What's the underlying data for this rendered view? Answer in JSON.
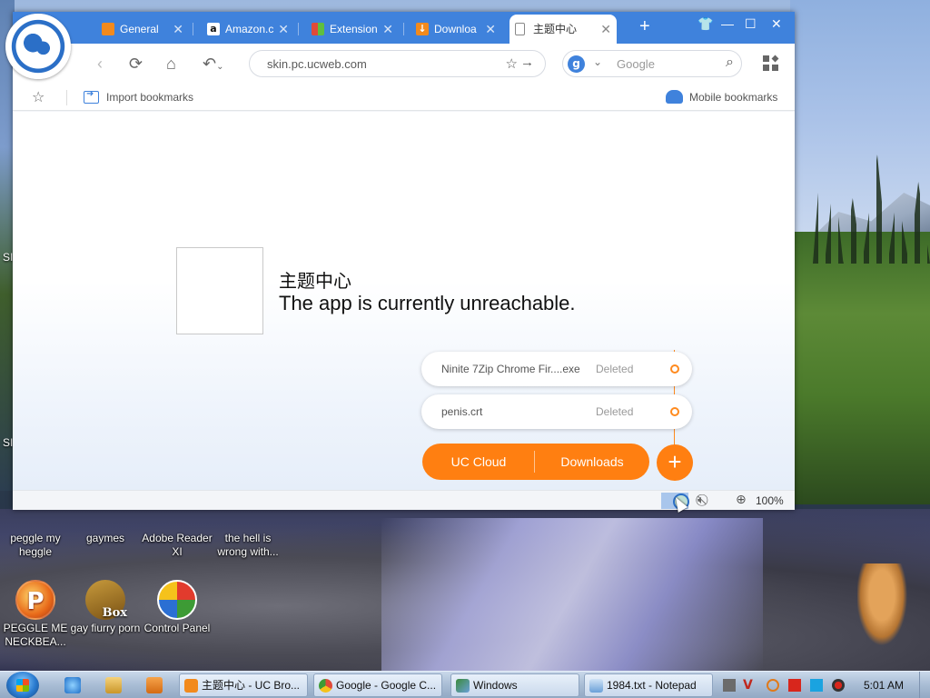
{
  "desktop": {
    "icons": [
      {
        "label": "peggle my heggle"
      },
      {
        "label": "gaymes"
      },
      {
        "label": "Adobe Reader XI"
      },
      {
        "label": "the hell is wrong with..."
      },
      {
        "label": "PEGGLE ME NECKBEA..."
      },
      {
        "label": "gay fiurry porn"
      },
      {
        "label": "Control Panel"
      }
    ],
    "edge_fragments": [
      "SI",
      "SI"
    ]
  },
  "browser": {
    "tabs": [
      {
        "label": "General",
        "icon": "gear-icon",
        "color": "#f28a1d"
      },
      {
        "label": "Amazon.c",
        "icon": "amazon-icon",
        "color": "#ffffff"
      },
      {
        "label": "Extension",
        "icon": "extension-icon",
        "color": "#5fbf3f"
      },
      {
        "label": "Downloa",
        "icon": "download-icon",
        "color": "#f28a1d"
      },
      {
        "label": "主题中心",
        "icon": "page-icon",
        "active": true
      }
    ],
    "address": "skin.pc.ucweb.com",
    "search_placeholder": "Google",
    "search_engine_icon": "g",
    "bookmarks": {
      "import_label": "Import bookmarks",
      "mobile_label": "Mobile bookmarks"
    },
    "page": {
      "title": "主题中心",
      "message": "The app is currently unreachable."
    },
    "downloads": [
      {
        "name": "Ninite 7Zip Chrome Fir....exe",
        "status": "Deleted"
      },
      {
        "name": "penis.crt",
        "status": "Deleted"
      }
    ],
    "actions": {
      "cloud_label": "UC Cloud",
      "downloads_label": "Downloads",
      "add_label": "+"
    },
    "statusbar": {
      "zoom": "100%"
    }
  },
  "taskbar": {
    "buttons": [
      {
        "label": "主题中心 - UC Bro...",
        "icon_color": "#f28a1d"
      },
      {
        "label": "Google - Google C...",
        "icon_color": "#e04a3a"
      },
      {
        "label": "Windows",
        "icon_color": "#3a8a3a"
      },
      {
        "label": "1984.txt - Notepad",
        "icon_color": "#6aa0d8"
      }
    ],
    "clock": "5:01 AM"
  },
  "colors": {
    "accent": "#3f82dc",
    "orange": "#ff7f11"
  }
}
